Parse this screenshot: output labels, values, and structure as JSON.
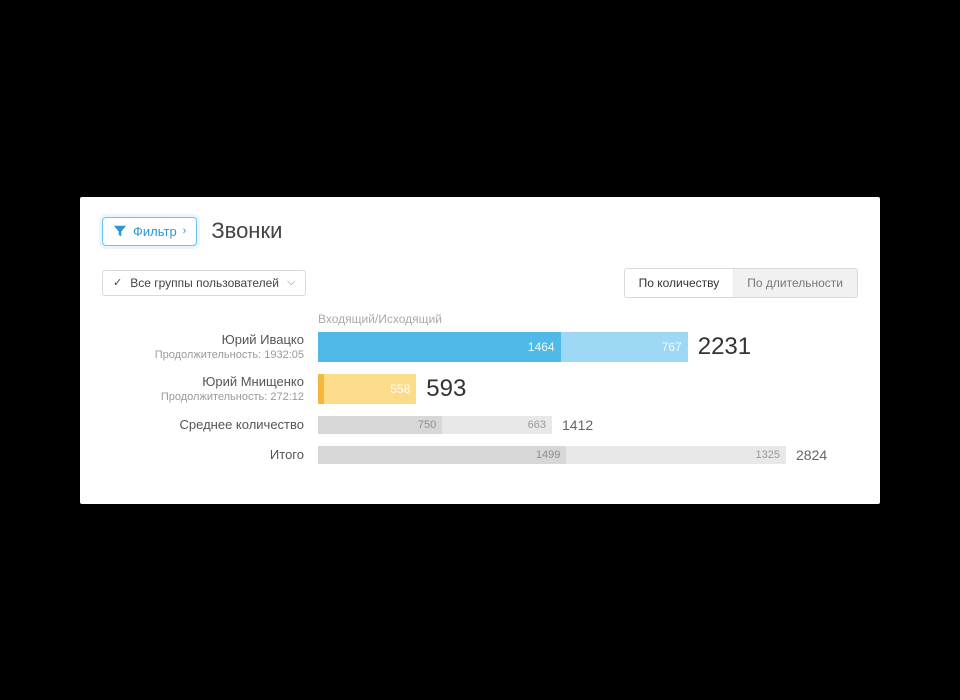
{
  "header": {
    "filter_label": "Фильтр",
    "title": "Звонки"
  },
  "controls": {
    "group_select": "Все группы пользователей",
    "tabs": {
      "by_count": "По количеству",
      "by_duration": "По длительности"
    },
    "active_tab": "by_count"
  },
  "axis_label": "Входящий/Исходящий",
  "chart_data": {
    "type": "bar",
    "orientation": "horizontal",
    "series_names": [
      "Входящий",
      "Исходящий"
    ],
    "max_total": 2824,
    "rows": [
      {
        "name": "Юрий Ивацко",
        "subtitle_prefix": "Продолжительность:",
        "duration": "1932:05",
        "values": [
          1464,
          767
        ],
        "total": 2231,
        "colors": [
          "#4fb9e8",
          "#9ed8f4"
        ],
        "size": "large"
      },
      {
        "name": "Юрий Мнищенко",
        "subtitle_prefix": "Продолжительность:",
        "duration": "272:12",
        "values": [
          35,
          558
        ],
        "total": 593,
        "colors": [
          "#f6b83c",
          "#fcdc8a"
        ],
        "size": "large"
      },
      {
        "name": "Среднее количество",
        "values": [
          750,
          663
        ],
        "total": 1412,
        "colors": [
          "#d7d7d7",
          "#e8e8e8"
        ],
        "size": "small"
      },
      {
        "name": "Итого",
        "values": [
          1499,
          1325
        ],
        "total": 2824,
        "colors": [
          "#d7d7d7",
          "#e8e8e8"
        ],
        "size": "small"
      }
    ]
  }
}
